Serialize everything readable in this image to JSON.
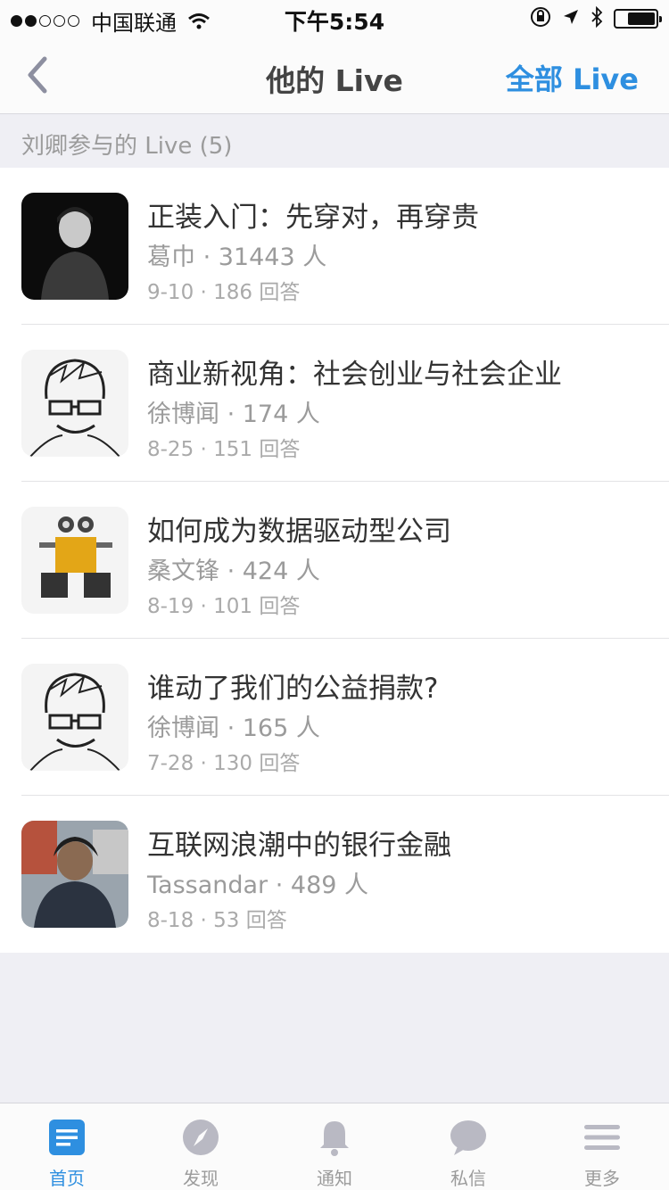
{
  "status_bar": {
    "carrier": "中国联通",
    "time": "下午5:54",
    "signal_dots": [
      true,
      true,
      false,
      false,
      false
    ]
  },
  "nav": {
    "title": "他的 Live",
    "right_label": "全部 Live"
  },
  "section": {
    "header": "刘卿参与的 Live (5)"
  },
  "lives": [
    {
      "title": "正装入门：先穿对，再穿贵",
      "host": "葛巾",
      "people": "31443 人",
      "date": "9-10",
      "answers": "186 回答",
      "meta": "葛巾 · 31443 人",
      "sub": "9-10 · 186 回答"
    },
    {
      "title": "商业新视角：社会创业与社会企业",
      "host": "徐博闻",
      "people": "174 人",
      "date": "8-25",
      "answers": "151 回答",
      "meta": "徐博闻 · 174 人",
      "sub": "8-25 · 151 回答"
    },
    {
      "title": "如何成为数据驱动型公司",
      "host": "桑文锋",
      "people": "424 人",
      "date": "8-19",
      "answers": "101 回答",
      "meta": "桑文锋 · 424 人",
      "sub": "8-19 · 101 回答"
    },
    {
      "title": "谁动了我们的公益捐款?",
      "host": "徐博闻",
      "people": "165 人",
      "date": "7-28",
      "answers": "130 回答",
      "meta": "徐博闻 · 165 人",
      "sub": "7-28 · 130 回答"
    },
    {
      "title": "互联网浪潮中的银行金融",
      "host": "Tassandar",
      "people": "489 人",
      "date": "8-18",
      "answers": "53 回答",
      "meta": "Tassandar · 489 人",
      "sub": "8-18 · 53 回答"
    }
  ],
  "tabs": [
    {
      "label": "首页",
      "icon": "home-icon",
      "active": true
    },
    {
      "label": "发现",
      "icon": "compass-icon",
      "active": false
    },
    {
      "label": "通知",
      "icon": "bell-icon",
      "active": false
    },
    {
      "label": "私信",
      "icon": "chat-bubble-icon",
      "active": false
    },
    {
      "label": "更多",
      "icon": "menu-icon",
      "active": false
    }
  ],
  "colors": {
    "accent": "#2e8fe0",
    "background": "#efeff4",
    "secondary_text": "#9b9b9b"
  }
}
